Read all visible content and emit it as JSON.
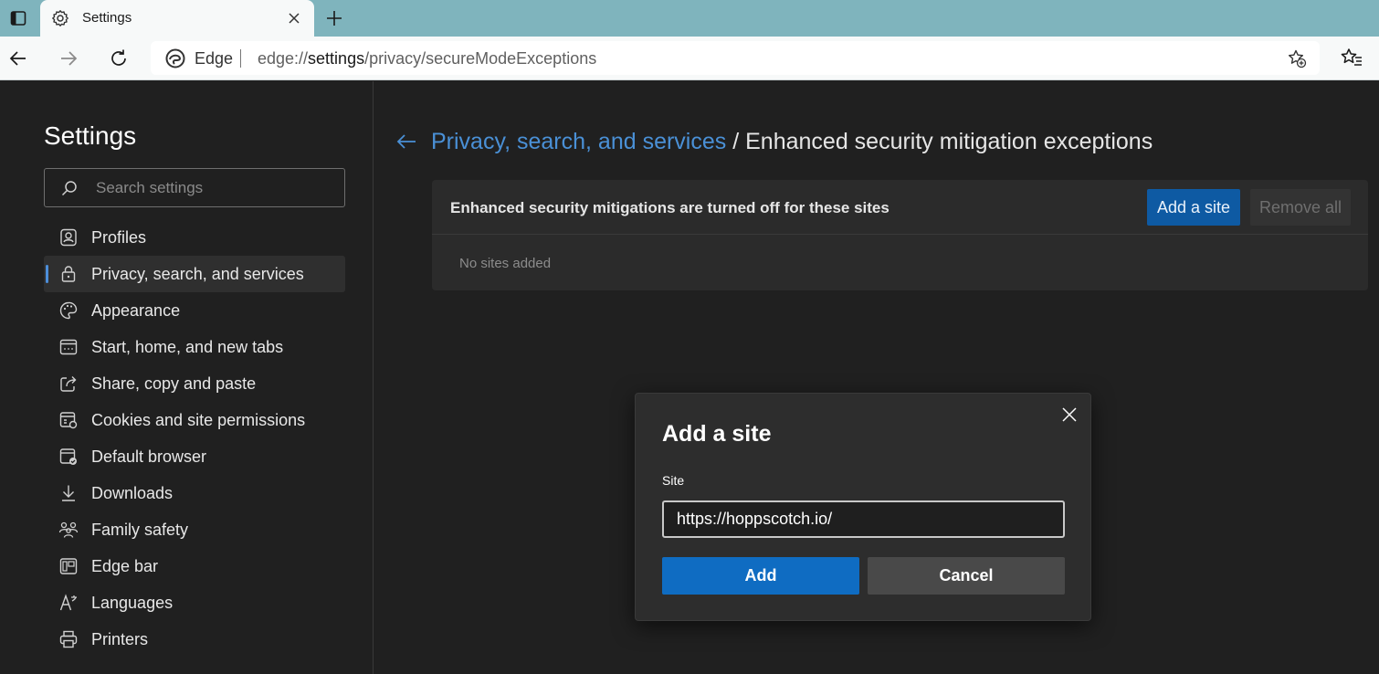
{
  "browser": {
    "tab": {
      "title": "Settings",
      "icon": "gear-icon"
    },
    "address": {
      "brand": "Edge",
      "url_scheme": "edge://",
      "url_host": "settings",
      "url_path": "/privacy/secureModeExceptions"
    }
  },
  "sidebar": {
    "title": "Settings",
    "search_placeholder": "Search settings",
    "items": [
      {
        "label": "Profiles",
        "icon": "profile-icon",
        "selected": false
      },
      {
        "label": "Privacy, search, and services",
        "icon": "lock-icon",
        "selected": true
      },
      {
        "label": "Appearance",
        "icon": "palette-icon",
        "selected": false
      },
      {
        "label": "Start, home, and new tabs",
        "icon": "home-tabs-icon",
        "selected": false
      },
      {
        "label": "Share, copy and paste",
        "icon": "share-icon",
        "selected": false
      },
      {
        "label": "Cookies and site permissions",
        "icon": "cookies-icon",
        "selected": false
      },
      {
        "label": "Default browser",
        "icon": "default-browser-icon",
        "selected": false
      },
      {
        "label": "Downloads",
        "icon": "download-icon",
        "selected": false
      },
      {
        "label": "Family safety",
        "icon": "family-icon",
        "selected": false
      },
      {
        "label": "Edge bar",
        "icon": "edge-bar-icon",
        "selected": false
      },
      {
        "label": "Languages",
        "icon": "languages-icon",
        "selected": false
      },
      {
        "label": "Printers",
        "icon": "printer-icon",
        "selected": false
      }
    ]
  },
  "main": {
    "breadcrumb_parent": "Privacy, search, and services",
    "breadcrumb_separator": " / ",
    "breadcrumb_current": "Enhanced security mitigation exceptions",
    "card": {
      "title": "Enhanced security mitigations are turned off for these sites",
      "add_button": "Add a site",
      "remove_all_button": "Remove all",
      "empty_text": "No sites added"
    }
  },
  "dialog": {
    "title": "Add a site",
    "field_label": "Site",
    "field_value": "https://hoppscotch.io/",
    "add_button": "Add",
    "cancel_button": "Cancel"
  },
  "colors": {
    "accent": "#0f6cc2",
    "link": "#4a90d6",
    "tabstrip": "#7fb4bd",
    "background": "#202020"
  }
}
